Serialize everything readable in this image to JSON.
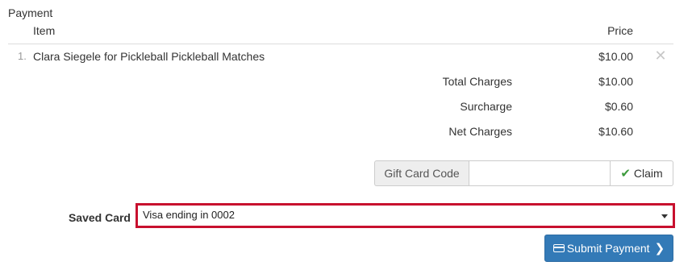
{
  "section": {
    "title": "Payment"
  },
  "table": {
    "headers": {
      "item": "Item",
      "price": "Price"
    },
    "rows": [
      {
        "number": "1.",
        "description": "Clara Siegele for Pickleball Pickleball Matches",
        "price": "$10.00",
        "remove_icon": "times-icon"
      }
    ]
  },
  "summary": {
    "total_label": "Total Charges",
    "total_value": "$10.00",
    "surcharge_label": "Surcharge",
    "surcharge_value": "$0.60",
    "net_label": "Net Charges",
    "net_value": "$10.60"
  },
  "gift_card": {
    "label": "Gift Card Code",
    "value": "",
    "placeholder": "",
    "claim_label": "Claim",
    "claim_icon": "check-icon"
  },
  "saved_card": {
    "label": "Saved Card",
    "selected": "Visa ending in 0002"
  },
  "submit": {
    "label": "Submit Payment",
    "icon": "credit-card-icon",
    "trailing_icon": "chevron-right-icon"
  },
  "colors": {
    "primary": "#337ab7",
    "highlight_border": "#c8102e",
    "success": "#3c9a3c"
  }
}
